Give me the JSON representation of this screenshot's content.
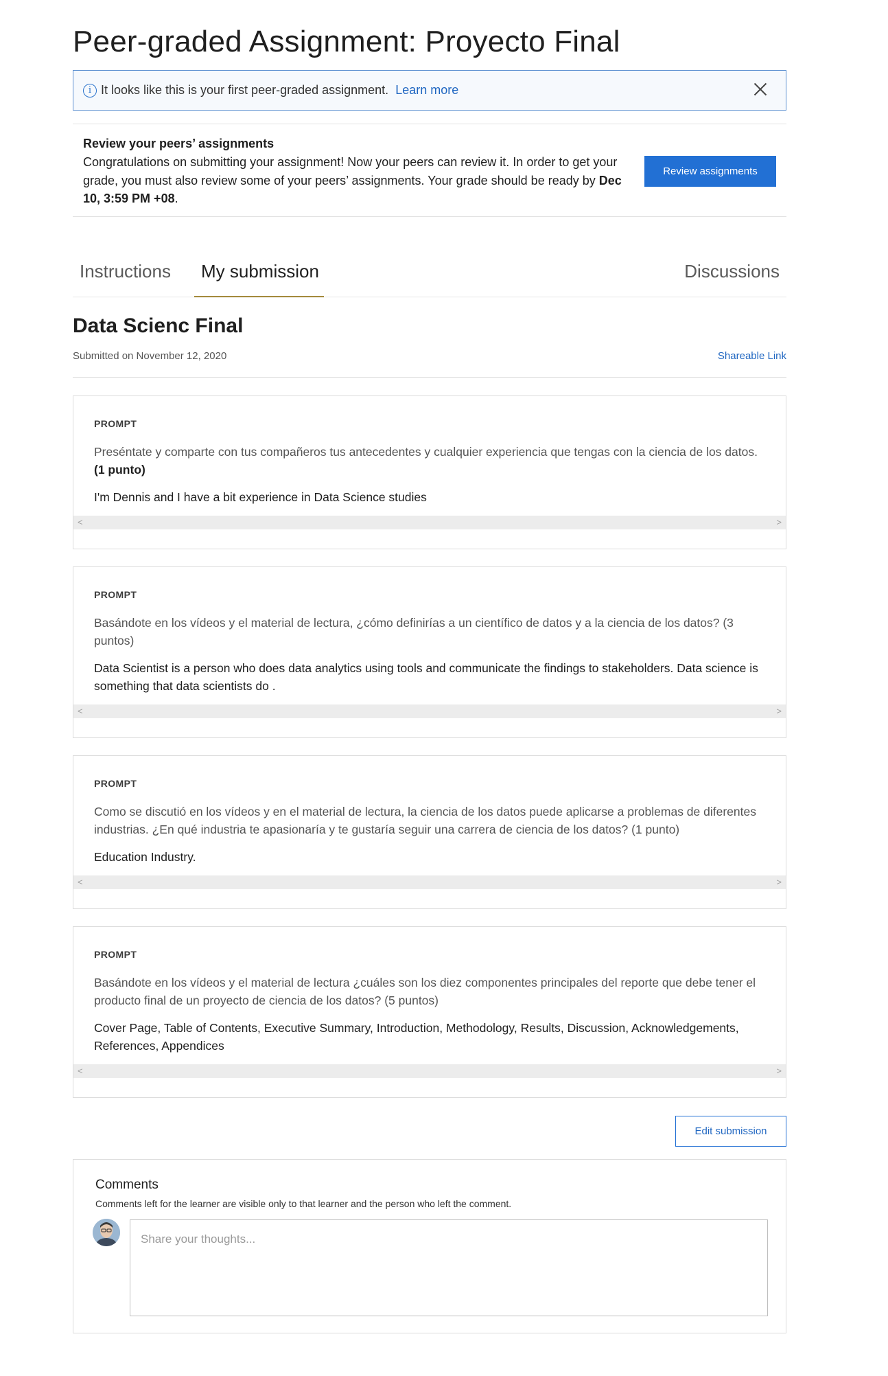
{
  "page": {
    "title": "Peer-graded Assignment: Proyecto Final"
  },
  "banner": {
    "text": "It looks like this is your first peer-graded assignment.",
    "link": "Learn more"
  },
  "review": {
    "title": "Review your peers’ assignments",
    "body_prefix": "Congratulations on submitting your assignment! Now your peers can review it. In order to get your grade, you must also review some of your peers’ assignments. Your grade should be ready by ",
    "deadline": "Dec 10, 3:59 PM +08",
    "body_suffix": ".",
    "button": "Review assignments"
  },
  "tabs": [
    {
      "label": "Instructions",
      "active": false
    },
    {
      "label": "My submission",
      "active": true
    },
    {
      "label": "Discussions",
      "active": false
    }
  ],
  "submission": {
    "title": "Data Scienc Final",
    "date": "Submitted on November 12, 2020",
    "share_link": "Shareable Link"
  },
  "prompts": [
    {
      "label": "PROMPT",
      "question": "Preséntate y comparte con tus compañeros tus antecedentes y cualquier experiencia que tengas con la ciencia de los datos. ",
      "points": "(1 punto)",
      "answer": "I'm Dennis and I have a bit experience in Data Science studies"
    },
    {
      "label": "PROMPT",
      "question": "Basándote en los vídeos y el material de lectura, ¿cómo definirías a un científico de datos y a la ciencia de los datos? (3 puntos)",
      "points": "",
      "answer": "Data Scientist is a person who does data analytics using tools and communicate the findings to stakeholders. Data science is something that data scientists do ."
    },
    {
      "label": "PROMPT",
      "question": "Como se discutió en los vídeos y en el material de lectura, la ciencia de los datos puede aplicarse a problemas de diferentes industrias. ¿En qué industria te apasionaría y te gustaría seguir una carrera de ciencia de los datos? (1 punto)",
      "points": "",
      "answer": "Education Industry."
    },
    {
      "label": "PROMPT",
      "question": "Basándote en los vídeos y el material de lectura ¿cuáles son los diez componentes principales del reporte que debe tener el producto final de un proyecto de ciencia de los datos? (5 puntos)",
      "points": "",
      "answer": "Cover Page, Table of Contents, Executive Summary, Introduction, Methodology, Results, Discussion, Acknowledgements, References, Appendices"
    }
  ],
  "edit_button": "Edit submission",
  "comments": {
    "title": "Comments",
    "note": "Comments left for the learner are visible only to that learner and the person who left the comment.",
    "placeholder": "Share your thoughts..."
  },
  "colors": {
    "primary": "#2270d4",
    "link": "#1f66c1",
    "tab_underline": "#a48a3c",
    "banner_border": "#5b8fd0"
  },
  "icons": {
    "info": "info-icon",
    "close": "close-icon",
    "scroll_left": "chevron-left-icon",
    "scroll_right": "chevron-right-icon"
  }
}
